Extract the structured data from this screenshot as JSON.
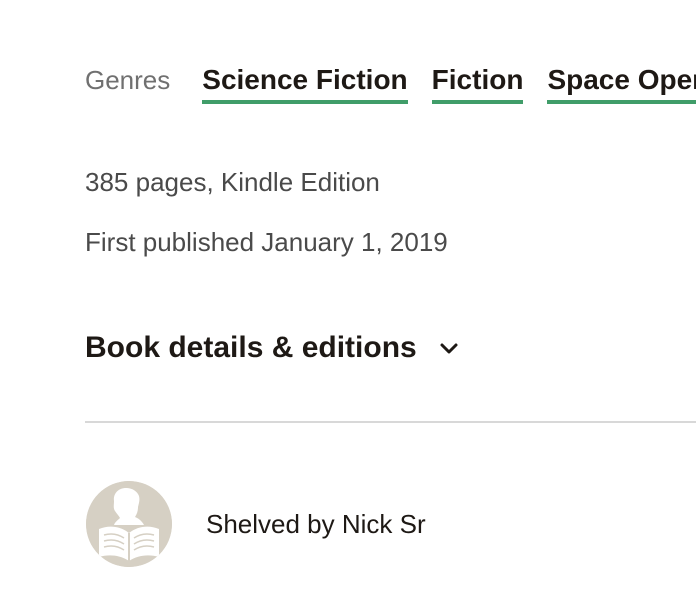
{
  "genres": {
    "label": "Genres",
    "items": [
      "Science Fiction",
      "Fiction",
      "Space Opera"
    ]
  },
  "book_meta": {
    "pages_format": "385 pages, Kindle Edition",
    "first_published": "First published January 1, 2019"
  },
  "details": {
    "label": "Book details & editions",
    "icon": "chevron-down-icon"
  },
  "shelved": {
    "text": "Shelved by Nick Sr",
    "avatar_icon": "reader-avatar-icon"
  },
  "colors": {
    "genre_underline": "#409d69",
    "text_primary": "#1e1915",
    "text_muted": "#707070",
    "divider": "#d8d8d8",
    "avatar_bg": "#d6d0c4"
  }
}
